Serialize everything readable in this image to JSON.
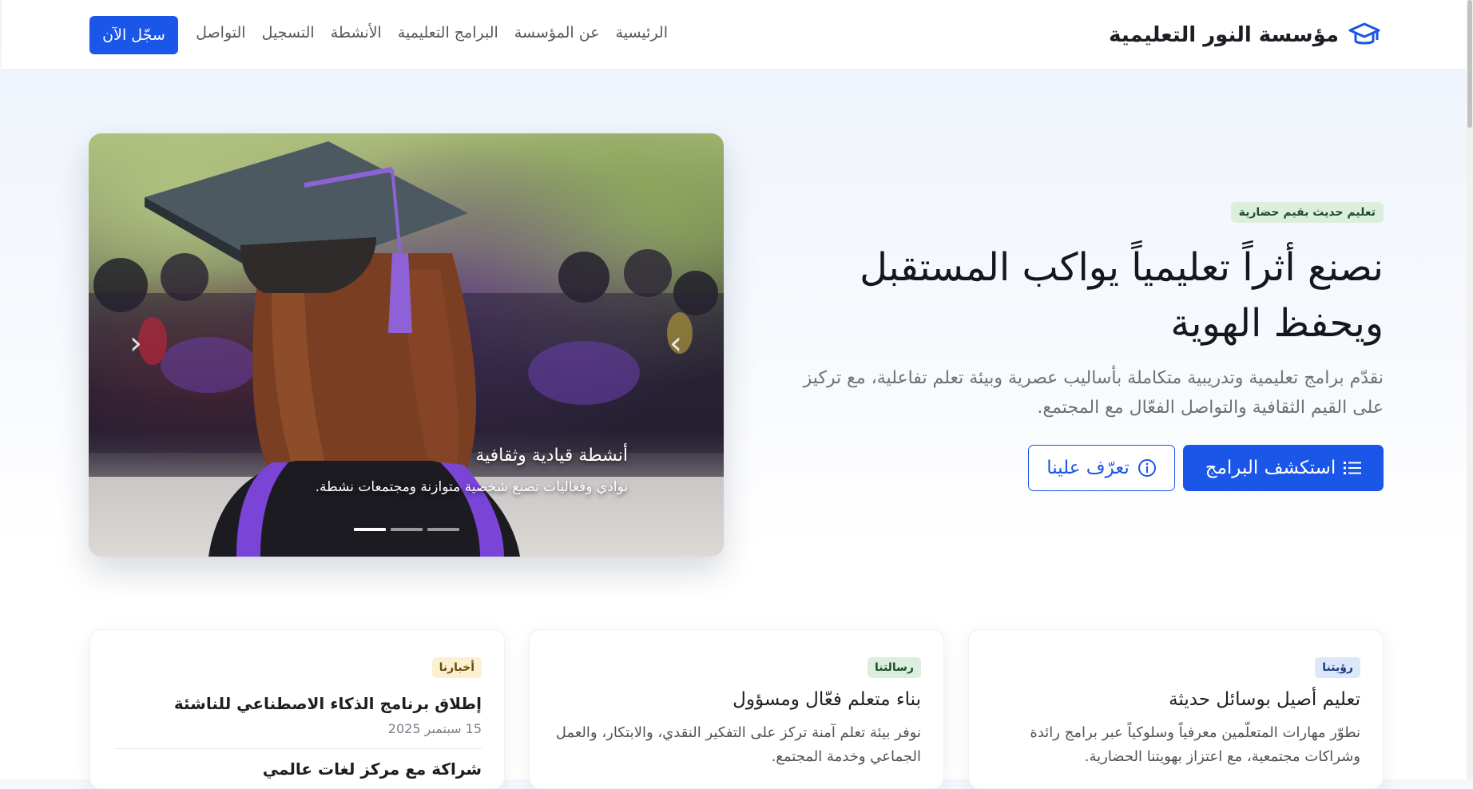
{
  "navbar": {
    "brand_name": "مؤسسة النور التعليمية",
    "brand_icon": "graduation-cap-icon",
    "links": [
      "الرئيسية",
      "عن المؤسسة",
      "البرامج التعليمية",
      "الأنشطة",
      "التسجيل",
      "التواصل"
    ],
    "cta_label": "سجّل الآن"
  },
  "hero": {
    "badge": "تعليم حديث بقيم حضارية",
    "title": "نصنع أثراً تعليمياً يواكب المستقبل ويحفظ الهوية",
    "subtitle": "نقدّم برامج تعليمية وتدريبية متكاملة بأساليب عصرية وبيئة تعلم تفاعلية، مع تركيز على القيم الثقافية والتواصل الفعّال مع المجتمع.",
    "primary_button": "استكشف البرامج",
    "primary_icon": "list-icon",
    "secondary_button": "تعرّف علينا",
    "secondary_icon": "info-circle-icon"
  },
  "carousel": {
    "caption_title": "أنشطة قيادية وثقافية",
    "caption_text": "نوادي وفعاليات تصنع شخصية متوازنة ومجتمعات نشطة.",
    "prev_icon": "chevron-left-icon",
    "next_icon": "chevron-right-icon",
    "slide_count": 3,
    "active_slide": 1
  },
  "cards": {
    "vision": {
      "badge": "رؤيتنا",
      "title": "تعليم أصيل بوسائل حديثة",
      "text": "نطوّر مهارات المتعلّمين معرفياً وسلوكياً عبر برامج رائدة وشراكات مجتمعية، مع اعتزاز بهويتنا الحضارية."
    },
    "mission": {
      "badge": "رسالتنا",
      "title": "بناء متعلم فعّال ومسؤول",
      "text": "نوفر بيئة تعلم آمنة تركز على التفكير النقدي، والابتكار، والعمل الجماعي وخدمة المجتمع."
    },
    "news": {
      "badge": "أخبارنا",
      "item1_title": "إطلاق برنامج الذكاء الاصطناعي للناشئة",
      "item1_date": "15 سبتمبر 2025",
      "item2_title": "شراكة مع مركز لغات عالمي"
    }
  },
  "colors": {
    "primary": "#1a56e8",
    "badge_green_bg": "#dcefdf",
    "badge_blue_bg": "#dde7fb",
    "badge_yellow_bg": "#fbf0cf"
  }
}
